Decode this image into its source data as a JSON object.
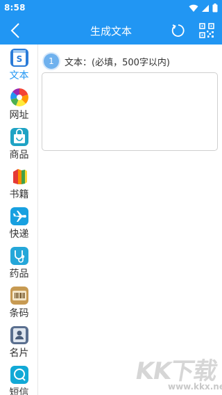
{
  "status_bar": {
    "time": "8:58"
  },
  "app_bar": {
    "title": "生成文本"
  },
  "sidebar": {
    "items": [
      {
        "label": "文本",
        "icon": "text-icon",
        "active": true
      },
      {
        "label": "网址",
        "icon": "url-icon",
        "active": false
      },
      {
        "label": "商品",
        "icon": "goods-icon",
        "active": false
      },
      {
        "label": "书籍",
        "icon": "book-icon",
        "active": false
      },
      {
        "label": "快递",
        "icon": "express-icon",
        "active": false
      },
      {
        "label": "药品",
        "icon": "medicine-icon",
        "active": false
      },
      {
        "label": "条码",
        "icon": "barcode-icon",
        "active": false
      },
      {
        "label": "名片",
        "icon": "card-icon",
        "active": false
      },
      {
        "label": "短信",
        "icon": "sms-icon",
        "active": false
      }
    ]
  },
  "main": {
    "step_number": "1",
    "step_label": "文本：(必填，500字以内)",
    "text_value": ""
  },
  "watermark": {
    "brand": "KK下载",
    "url": "www.kkx.net"
  },
  "colors": {
    "primary": "#2196f3",
    "active_label": "#2196f3",
    "badge": "#6fb1ee"
  }
}
